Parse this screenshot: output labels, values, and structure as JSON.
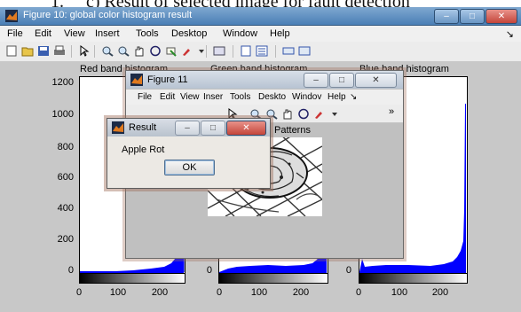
{
  "caption": {
    "number": "1.",
    "text": "c) Result of selected image for fault detection"
  },
  "main_window": {
    "title": "Figure 10: global color histogram result",
    "min": "–",
    "max": "□",
    "close": "✕"
  },
  "menu": [
    "File",
    "Edit",
    "View",
    "Insert",
    "Tools",
    "Desktop",
    "Window",
    "Help"
  ],
  "menu_arrow": "↘",
  "axes_titles": [
    "Red band histogram",
    "Green band histogram",
    "Blue band histogram"
  ],
  "y_ticks": [
    "1200",
    "1000",
    "800",
    "600",
    "400",
    "200",
    "0"
  ],
  "x_ticks": [
    "0",
    "100",
    "200"
  ],
  "small_y_tick": "0",
  "figure11": {
    "title": "Figure 11",
    "menu": [
      "File",
      "Edit",
      "View",
      "Inser",
      "Tools",
      "Deskto",
      "Windov",
      "Help"
    ],
    "menu_arrow": "↘",
    "toolbar_more": "»",
    "image_title": "Patterns"
  },
  "result": {
    "title": "Result",
    "message": "Apple Rot",
    "ok": "OK"
  },
  "colors": {
    "histogram_fill": "#0000ff",
    "figure_bg": "#c8c8c8",
    "titlebar_accent": "#4a7fb6"
  }
}
